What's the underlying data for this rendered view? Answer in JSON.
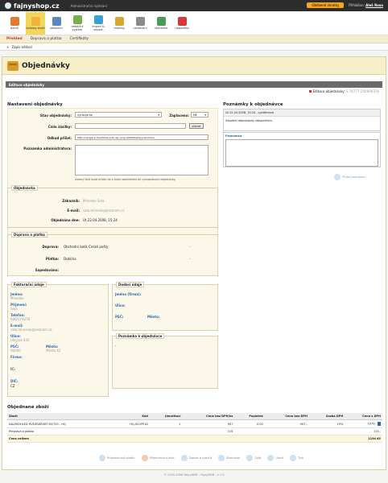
{
  "app": {
    "logo": "fajnyshop.cz",
    "tagline": "Administrační rozhraní",
    "shortcut_btn": "Oblíbené zkratky",
    "user_label": "Přihlášen:",
    "user_name": "Aleš Rosa"
  },
  "toolbar": [
    {
      "label": "domů",
      "color": "#e57a2c"
    },
    {
      "label": "katalog zboží",
      "color": "#f2b33a"
    },
    {
      "label": "zákazníci",
      "color": "#5a86c4"
    },
    {
      "label": "redakční systém",
      "color": "#76b04a"
    },
    {
      "label": "import & export",
      "color": "#3a9fd4"
    },
    {
      "label": "mailing",
      "color": "#d7a830"
    },
    {
      "label": "nastavení",
      "color": "#8a8a8a"
    },
    {
      "label": "statistika",
      "color": "#4a9a5a"
    },
    {
      "label": "nápověda",
      "color": "#d43a3a"
    }
  ],
  "subnav": [
    "Přehled",
    "Doprava a platba",
    "Certifikáty"
  ],
  "editstrip": {
    "label": "Zápis editací"
  },
  "page": {
    "title": "Objednávky",
    "section": "Editace objednávky",
    "edit_ref_label": "Editace objednávky:",
    "edit_ref_value": "S 76777-2008/9/376"
  },
  "settings": {
    "heading": "Nastavení objednávky",
    "status_label": "Stav objednávky:",
    "status_value": "vyřizuje se",
    "paid_label": "Zaplaceno:",
    "paid_value": "NE",
    "shipment_label": "Číslo zásilky:",
    "show_btn": "ukázat",
    "ref_label": "Odkud přišel:",
    "ref_value": "http://navigace-handsfree-pda.nej-ceny.cz/600/testery-alkoholu/",
    "admin_note_label": "Poznámka administrátora:",
    "admin_note_hint": "Zadaný text bude přidán do e-mailu odesílaném při vyexpedování objednávky."
  },
  "notes": {
    "heading": "Poznámky k objednávce",
    "entry_time": "Út 22.04.2008, 15:24 - systémová",
    "entry_text": "Založení objednávky zákazníkem.",
    "note_label": "Poznámka:",
    "add_btn": "Přidat poznámku"
  },
  "order": {
    "legend": "Objednávka",
    "customer_label": "Zákazník:",
    "customer_value": "Miroslav Sala",
    "email_label": "E-mail:",
    "email_value": "sala.miroslav@seznam.cz",
    "date_label": "Objednáno dne:",
    "date_value": "Út 22.04.2008, 15:24"
  },
  "shipping": {
    "legend": "Doprava a platba",
    "delivery_label": "Doprava:",
    "delivery_value": "Obchodní balík České pošty",
    "payment_label": "Platba:",
    "payment_value": "Dobírka",
    "dispatch_label": "Expedováno:",
    "dash": "-"
  },
  "billing": {
    "legend": "Fakturační údaje",
    "name_label": "Jméno:",
    "name_value": "Miroslav",
    "surname_label": "Příjmení:",
    "surname_value": "Sala",
    "phone_label": "Telefon:",
    "phone_value": "606/174476",
    "email_label": "E-mail:",
    "email_value": "sala.miroslav@seznam.cz",
    "street_label": "Ulice:",
    "street_value": "Ulicová 435",
    "zip_label": "PSČ:",
    "zip_value": "00000",
    "city_label": "Město:",
    "city_value": "Město 42",
    "company_label": "Firma:",
    "ico_label": "IČ:",
    "dic_label": "DIČ:",
    "dic_value": "CZ"
  },
  "delivery_addr": {
    "legend": "Dodací údaje",
    "name_label": "Jméno (firma):",
    "street_label": "Ulice:",
    "zip_label": "PSČ:",
    "city_label": "Město:"
  },
  "order_note": {
    "legend": "Poznámka k objednávce",
    "value": "-"
  },
  "items": {
    "heading": "Objednané zboží",
    "columns": [
      "Zboží",
      "Kód",
      "Jimočítací",
      "Cena bez DPH/ks",
      "Poplatek",
      "Cena bez DPH",
      "Sazba DPH",
      "Cena s DPH"
    ],
    "rows": [
      [
        "DALEKOHLED HVĚZDÁŘSKÝ 60/700 - HQ",
        "HQ.SCOPE40",
        "1",
        "907",
        "0.00",
        "907,-",
        "19%",
        "1079,-"
      ],
      [
        "Přeprava a platba",
        "",
        "",
        "115",
        "",
        "",
        "",
        "115,-"
      ]
    ],
    "total_label": "Cena celkem",
    "total_value": "1194 Kč"
  },
  "actions": [
    "Připomenout platbu",
    "Připomenout tiskt",
    "Zapsat a uzavřít",
    "Stornovat",
    "Zpět",
    "Uložit",
    "Tisk"
  ],
  "footer": "© 2005-2008 FajnyWEB - FajnyWEB - v 1.5"
}
